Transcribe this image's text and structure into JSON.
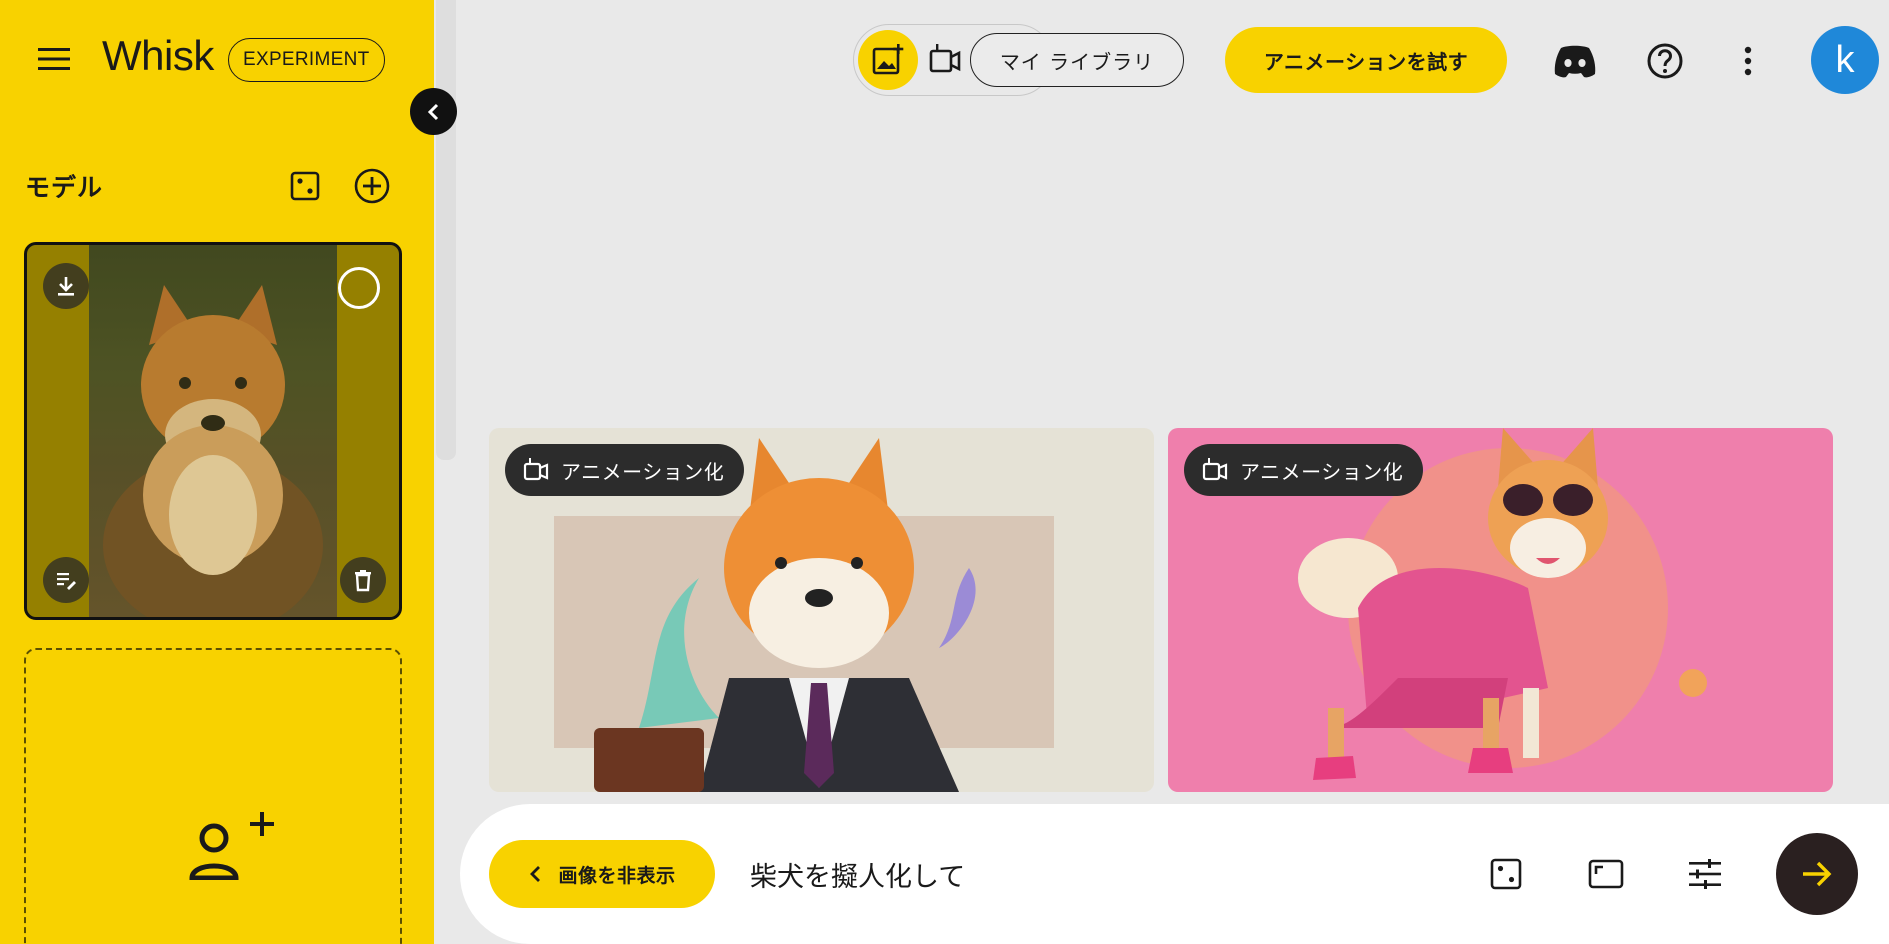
{
  "app": {
    "title": "Whisk",
    "badge": "EXPERIMENT"
  },
  "sidebar": {
    "section_title": "モデル",
    "icons": {
      "menu": "menu-icon",
      "dice": "dice-icon",
      "add": "add-circle-icon",
      "collapse": "chevron-left-icon"
    },
    "model_card": {
      "icons": [
        "download-icon",
        "select-circle",
        "edit-prompt-icon",
        "delete-icon"
      ]
    },
    "add_card": {
      "icon": "add-person-icon"
    }
  },
  "topbar": {
    "mode_icons": [
      "image-mode-icon",
      "video-mode-icon"
    ],
    "library_label": "マイ ライブラリ",
    "animate_label": "アニメーションを試す",
    "icons": [
      "discord-icon",
      "help-icon",
      "more-vert-icon"
    ],
    "avatar_letter": "k"
  },
  "gallery": {
    "cards": [
      {
        "chip_label": "アニメーション化"
      },
      {
        "chip_label": "アニメーション化"
      }
    ]
  },
  "prompt": {
    "hide_label": "画像を非表示",
    "value": "柴犬を擬人化して",
    "icons": [
      "dice-icon",
      "aspect-ratio-icon",
      "tune-icon",
      "send-arrow-icon"
    ]
  },
  "colors": {
    "accent": "#f8d200",
    "background": "#e9e9e9",
    "avatar": "#1f88d9",
    "send": "#2a2020"
  }
}
